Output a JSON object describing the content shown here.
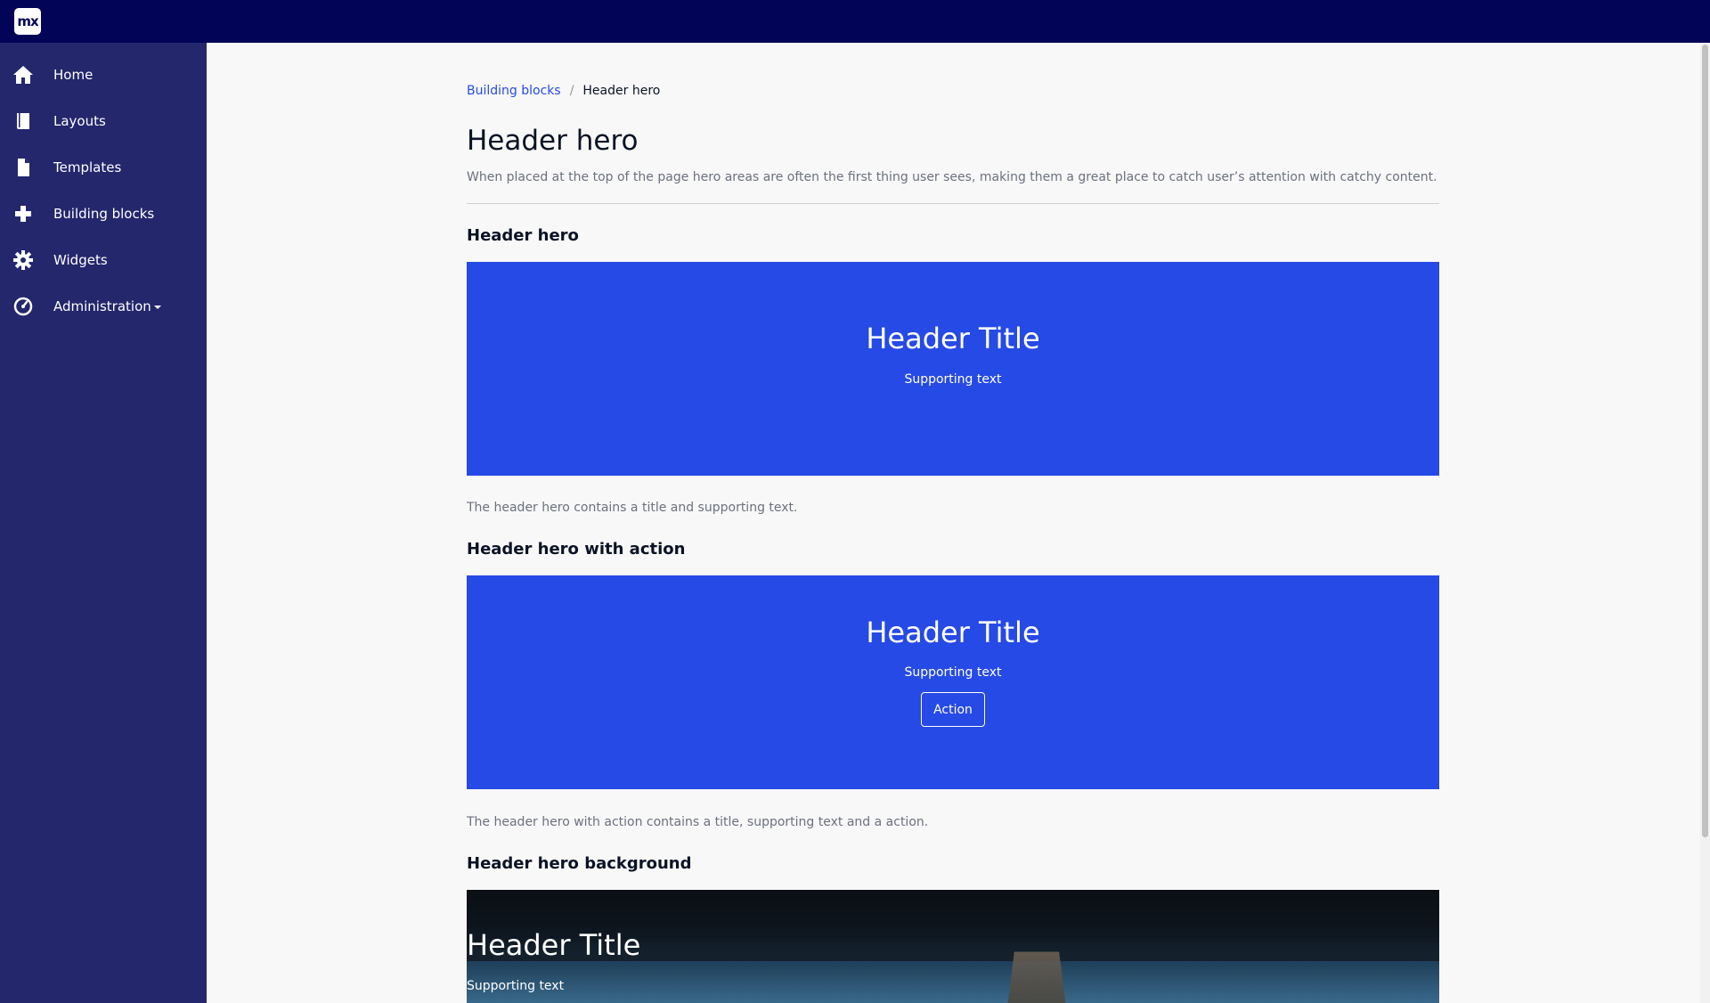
{
  "topbar": {
    "logo_text": "mx"
  },
  "sidebar": {
    "items": [
      {
        "label": "Home",
        "icon": "home-icon"
      },
      {
        "label": "Layouts",
        "icon": "book-icon"
      },
      {
        "label": "Templates",
        "icon": "file-icon"
      },
      {
        "label": "Building blocks",
        "icon": "plus-icon"
      },
      {
        "label": "Widgets",
        "icon": "gear-icon"
      },
      {
        "label": "Administration",
        "icon": "dashboard-icon",
        "has_dropdown": true
      }
    ]
  },
  "breadcrumb": {
    "parent": "Building blocks",
    "separator": "/",
    "current": "Header hero"
  },
  "page": {
    "title": "Header hero",
    "description": "When placed at the top of the page hero areas are often the first thing user sees, making them a great place to catch user’s attention with catchy content."
  },
  "sections": [
    {
      "title": "Header hero",
      "hero_title": "Header Title",
      "hero_sub": "Supporting text",
      "description": "The header hero contains a title and supporting text."
    },
    {
      "title": "Header hero with action",
      "hero_title": "Header Title",
      "hero_sub": "Supporting text",
      "action_label": "Action",
      "description": "The header hero with action contains a title, supporting text and a action."
    },
    {
      "title": "Header hero background",
      "hero_title": "Header Title",
      "hero_sub": "Supporting text"
    }
  ],
  "colors": {
    "topbar": "#020557",
    "sidebar": "#24276c",
    "hero": "#264ae5",
    "link": "#264ae5"
  }
}
